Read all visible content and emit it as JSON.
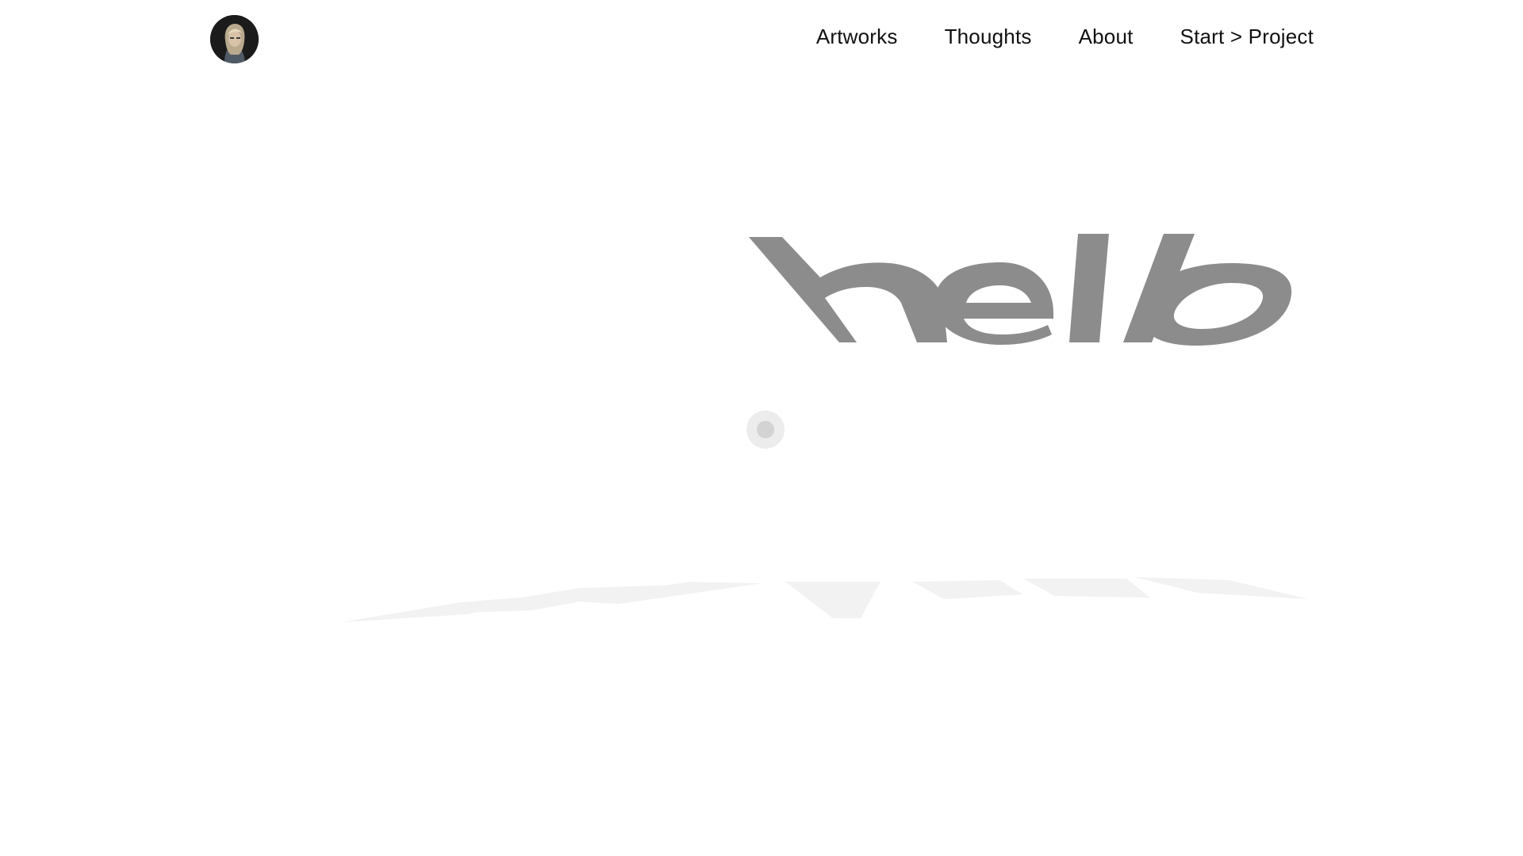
{
  "header": {
    "avatar_icon": "portrait-avatar",
    "nav": {
      "artworks": "Artworks",
      "thoughts": "Thoughts",
      "about": "About",
      "start_project": "Start > Project"
    }
  },
  "hero": {
    "word": "hello",
    "color": "#8c8c8c",
    "reflection_color": "#f2f2f2"
  },
  "cursor": {
    "icon": "cursor-dot-icon"
  }
}
